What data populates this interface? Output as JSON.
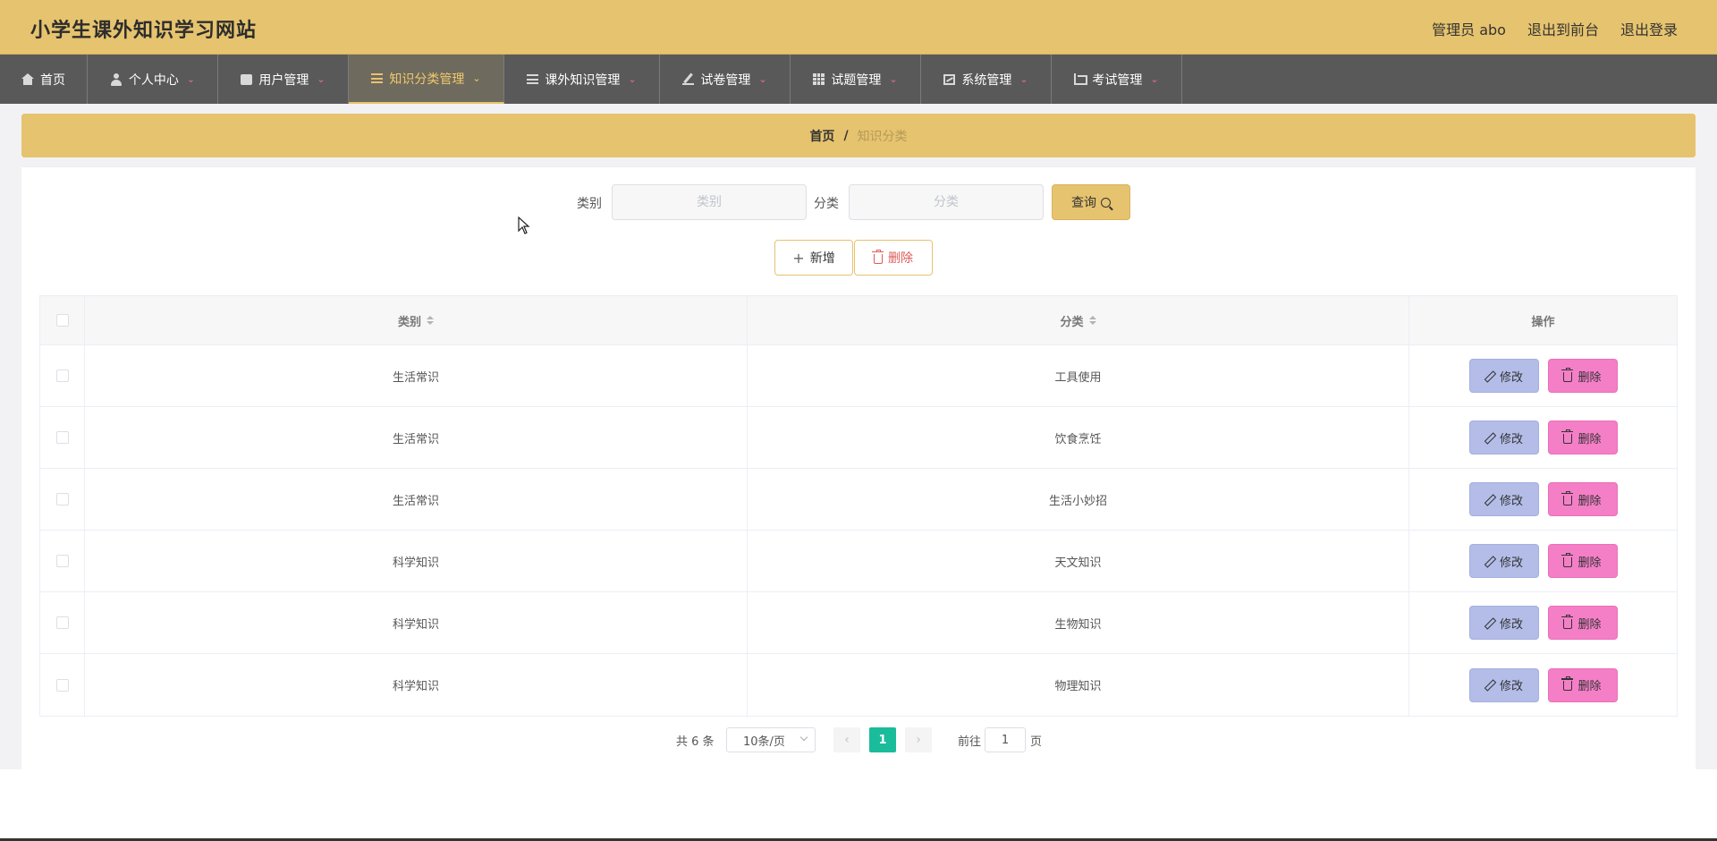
{
  "header": {
    "site_title": "小学生课外知识学习网站",
    "admin_label": "管理员 abo",
    "back_to_front": "退出到前台",
    "logout": "退出登录"
  },
  "nav": [
    {
      "label": "首页",
      "icon": "home-icon",
      "has_dropdown": false
    },
    {
      "label": "个人中心",
      "icon": "user-icon",
      "has_dropdown": true
    },
    {
      "label": "用户管理",
      "icon": "box-icon",
      "has_dropdown": true
    },
    {
      "label": "知识分类管理",
      "icon": "list-icon",
      "has_dropdown": true,
      "active": true
    },
    {
      "label": "课外知识管理",
      "icon": "list-icon",
      "has_dropdown": true
    },
    {
      "label": "试卷管理",
      "icon": "pen-icon",
      "has_dropdown": true
    },
    {
      "label": "试题管理",
      "icon": "grid-icon",
      "has_dropdown": true
    },
    {
      "label": "系统管理",
      "icon": "chart-icon",
      "has_dropdown": true
    },
    {
      "label": "考试管理",
      "icon": "crop-icon",
      "has_dropdown": true
    }
  ],
  "breadcrumb": {
    "home": "首页",
    "separator": "/",
    "current": "知识分类"
  },
  "search": {
    "category_label": "类别",
    "category_placeholder": "类别",
    "category_value": "",
    "type_label": "分类",
    "type_placeholder": "分类",
    "type_value": "",
    "query_button": "查询"
  },
  "actions": {
    "add_button": "新增",
    "delete_button": "删除"
  },
  "table": {
    "columns": [
      "类别",
      "分类",
      "操作"
    ],
    "rows": [
      {
        "category": "生活常识",
        "type": "工具使用"
      },
      {
        "category": "生活常识",
        "type": "饮食烹饪"
      },
      {
        "category": "生活常识",
        "type": "生活小妙招"
      },
      {
        "category": "科学知识",
        "type": "天文知识"
      },
      {
        "category": "科学知识",
        "type": "生物知识"
      },
      {
        "category": "科学知识",
        "type": "物理知识"
      }
    ],
    "edit_label": "修改",
    "delete_label": "删除"
  },
  "pagination": {
    "total_text": "共 6 条",
    "page_size": "10条/页",
    "prev": "‹",
    "current_page": "1",
    "next": "›",
    "goto_label": "前往",
    "goto_value": "1",
    "page_suffix": "页"
  },
  "colors": {
    "header_bg": "#e6c36e",
    "nav_bg": "#595959",
    "edit_button": "#b3bde8",
    "delete_button": "#f47fc7",
    "active_page": "#1abc9c"
  }
}
